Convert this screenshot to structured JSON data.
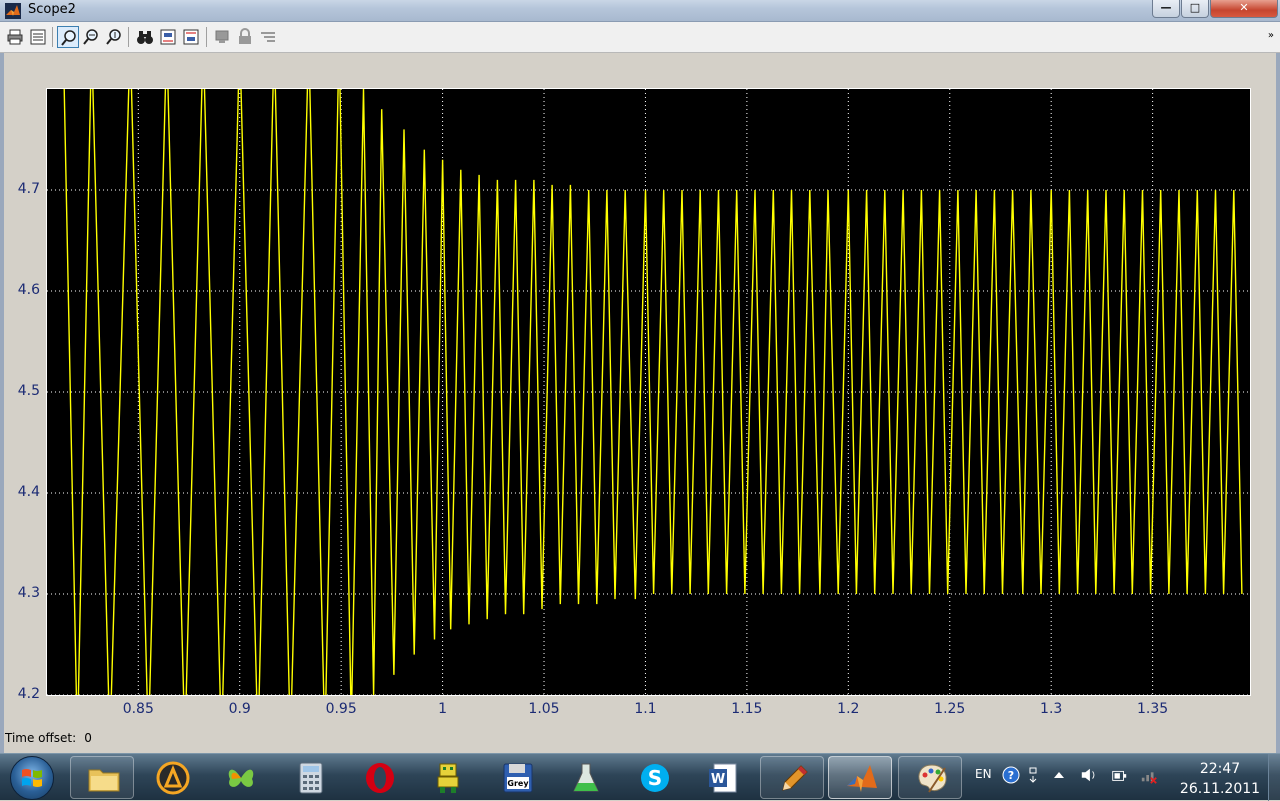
{
  "window": {
    "title": "Scope2",
    "minimize_label": "—",
    "maximize_label": "□",
    "close_label": "✕"
  },
  "toolbar": {
    "buttons": [
      {
        "name": "print",
        "icon": "printer-icon"
      },
      {
        "name": "parameters",
        "icon": "parameters-icon"
      },
      {
        "name": "zoom",
        "icon": "zoom-icon",
        "active": true
      },
      {
        "name": "zoom-x",
        "icon": "zoom-x-icon"
      },
      {
        "name": "zoom-y",
        "icon": "zoom-y-icon"
      },
      {
        "name": "autoscale",
        "icon": "binoculars-icon"
      },
      {
        "name": "save-axes",
        "icon": "save-axes-icon"
      },
      {
        "name": "restore-axes",
        "icon": "restore-axes-icon"
      },
      {
        "name": "floating-scope",
        "icon": "floating-scope-icon"
      },
      {
        "name": "lock-axes",
        "icon": "lock-icon"
      },
      {
        "name": "signal-selector",
        "icon": "signal-selector-icon"
      }
    ],
    "overflow_label": "»"
  },
  "chart_data": {
    "type": "line",
    "title": "",
    "xlabel": "",
    "ylabel": "",
    "xlim": [
      0.805,
      1.398
    ],
    "ylim": [
      4.2,
      4.8
    ],
    "xticks": [
      0.85,
      0.9,
      0.95,
      1,
      1.05,
      1.1,
      1.15,
      1.2,
      1.25,
      1.3,
      1.35
    ],
    "xtick_labels": [
      "0.85",
      "0.9",
      "0.95",
      "1",
      "1.05",
      "1.1",
      "1.15",
      "1.2",
      "1.25",
      "1.3",
      "1.35"
    ],
    "yticks": [
      4.2,
      4.3,
      4.4,
      4.5,
      4.6,
      4.7
    ],
    "ytick_labels": [
      "4.2",
      "4.3",
      "4.4",
      "4.5",
      "4.6",
      "4.7"
    ],
    "grid": true,
    "background": "#000000",
    "series": [
      {
        "color": "#ffff00",
        "description_points": "sawtooth-like oscillation; period ~0.0093 s; amplitude decays from beyond axes to steady 4.30-4.70 band by ~1.07 s",
        "peaks": [
          [
            0.813,
            4.85
          ],
          [
            0.827,
            4.85
          ],
          [
            0.846,
            4.85
          ],
          [
            0.864,
            4.85
          ],
          [
            0.882,
            4.85
          ],
          [
            0.9,
            4.85
          ],
          [
            0.917,
            4.85
          ],
          [
            0.934,
            4.85
          ],
          [
            0.949,
            4.85
          ],
          [
            0.961,
            4.8
          ],
          [
            0.97,
            4.78
          ],
          [
            0.981,
            4.76
          ],
          [
            0.991,
            4.74
          ],
          [
            1.0,
            4.73
          ],
          [
            1.009,
            4.72
          ],
          [
            1.018,
            4.715
          ],
          [
            1.027,
            4.71
          ],
          [
            1.036,
            4.71
          ],
          [
            1.045,
            4.71
          ],
          [
            1.054,
            4.705
          ],
          [
            1.063,
            4.705
          ],
          [
            1.072,
            4.7
          ],
          [
            1.081,
            4.7
          ],
          [
            1.09,
            4.7
          ],
          [
            1.1,
            4.7
          ],
          [
            1.109,
            4.7
          ],
          [
            1.118,
            4.7
          ],
          [
            1.127,
            4.7
          ],
          [
            1.136,
            4.7
          ],
          [
            1.145,
            4.7
          ],
          [
            1.154,
            4.7
          ],
          [
            1.163,
            4.7
          ],
          [
            1.172,
            4.7
          ],
          [
            1.181,
            4.7
          ],
          [
            1.19,
            4.7
          ],
          [
            1.2,
            4.7
          ],
          [
            1.209,
            4.7
          ],
          [
            1.218,
            4.7
          ],
          [
            1.227,
            4.7
          ],
          [
            1.236,
            4.7
          ],
          [
            1.245,
            4.7
          ],
          [
            1.254,
            4.7
          ],
          [
            1.263,
            4.7
          ],
          [
            1.272,
            4.7
          ],
          [
            1.281,
            4.7
          ],
          [
            1.29,
            4.7
          ],
          [
            1.3,
            4.7
          ],
          [
            1.309,
            4.7
          ],
          [
            1.318,
            4.7
          ],
          [
            1.327,
            4.7
          ],
          [
            1.336,
            4.7
          ],
          [
            1.345,
            4.7
          ],
          [
            1.354,
            4.7
          ],
          [
            1.363,
            4.7
          ],
          [
            1.372,
            4.7
          ],
          [
            1.381,
            4.7
          ],
          [
            1.39,
            4.7
          ]
        ],
        "troughs": [
          [
            0.82,
            4.15
          ],
          [
            0.836,
            4.15
          ],
          [
            0.855,
            4.15
          ],
          [
            0.873,
            4.15
          ],
          [
            0.891,
            4.15
          ],
          [
            0.909,
            4.15
          ],
          [
            0.925,
            4.15
          ],
          [
            0.942,
            4.15
          ],
          [
            0.955,
            4.17
          ],
          [
            0.966,
            4.2
          ],
          [
            0.976,
            4.22
          ],
          [
            0.986,
            4.24
          ],
          [
            0.996,
            4.255
          ],
          [
            1.004,
            4.265
          ],
          [
            1.013,
            4.27
          ],
          [
            1.022,
            4.275
          ],
          [
            1.031,
            4.28
          ],
          [
            1.04,
            4.28
          ],
          [
            1.049,
            4.285
          ],
          [
            1.058,
            4.29
          ],
          [
            1.067,
            4.29
          ],
          [
            1.076,
            4.29
          ],
          [
            1.085,
            4.295
          ],
          [
            1.095,
            4.295
          ],
          [
            1.104,
            4.3
          ],
          [
            1.113,
            4.3
          ],
          [
            1.122,
            4.3
          ],
          [
            1.131,
            4.3
          ],
          [
            1.14,
            4.3
          ],
          [
            1.149,
            4.3
          ],
          [
            1.158,
            4.3
          ],
          [
            1.167,
            4.3
          ],
          [
            1.176,
            4.3
          ],
          [
            1.186,
            4.3
          ],
          [
            1.195,
            4.3
          ],
          [
            1.204,
            4.3
          ],
          [
            1.213,
            4.3
          ],
          [
            1.222,
            4.3
          ],
          [
            1.231,
            4.3
          ],
          [
            1.24,
            4.3
          ],
          [
            1.249,
            4.3
          ],
          [
            1.258,
            4.3
          ],
          [
            1.267,
            4.3
          ],
          [
            1.276,
            4.3
          ],
          [
            1.286,
            4.3
          ],
          [
            1.295,
            4.3
          ],
          [
            1.304,
            4.3
          ],
          [
            1.313,
            4.3
          ],
          [
            1.322,
            4.3
          ],
          [
            1.331,
            4.3
          ],
          [
            1.34,
            4.3
          ],
          [
            1.349,
            4.3
          ],
          [
            1.358,
            4.3
          ],
          [
            1.367,
            4.3
          ],
          [
            1.376,
            4.3
          ],
          [
            1.385,
            4.3
          ],
          [
            1.394,
            4.3
          ]
        ]
      }
    ]
  },
  "statusbar": {
    "time_offset_label": "Time offset:",
    "time_offset_value": "0"
  },
  "taskbar": {
    "apps": [
      {
        "name": "explorer",
        "icon": "folder-icon"
      },
      {
        "name": "aimp",
        "icon": "aimp-icon"
      },
      {
        "name": "app-butterfly",
        "icon": "butterfly-icon"
      },
      {
        "name": "calculator",
        "icon": "calculator-icon"
      },
      {
        "name": "opera",
        "icon": "opera-icon"
      },
      {
        "name": "app-robot",
        "icon": "robot-icon"
      },
      {
        "name": "grey-disk",
        "icon": "floppy-icon",
        "label": "Grey"
      },
      {
        "name": "app-flask",
        "icon": "flask-icon"
      },
      {
        "name": "skype",
        "icon": "skype-icon"
      },
      {
        "name": "word",
        "icon": "word-icon"
      },
      {
        "name": "paint-pencil",
        "icon": "pencil-icon"
      },
      {
        "name": "matlab",
        "icon": "matlab-icon"
      },
      {
        "name": "paint",
        "icon": "palette-icon"
      }
    ],
    "tray": {
      "language": "EN",
      "time": "22:47",
      "date": "26.11.2011"
    }
  }
}
